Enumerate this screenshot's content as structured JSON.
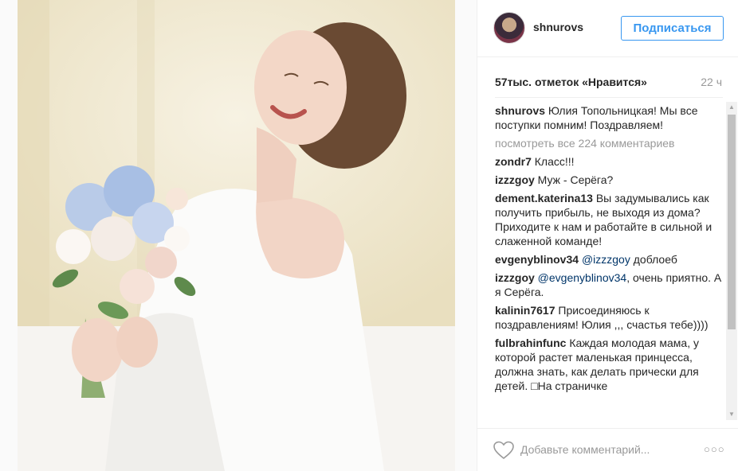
{
  "post": {
    "username": "shnurovs",
    "follow_label": "Подписаться",
    "likes": "57тыс. отметок «Нравится»",
    "time": "22 ч"
  },
  "comments": {
    "caption": {
      "user": "shnurovs",
      "text": "Юлия Топольницкая! Мы все поступки помним! Поздравляем!"
    },
    "view_all": "посмотреть все 224 комментариев",
    "items": [
      {
        "user": "zondr7",
        "text": "Класс!!!"
      },
      {
        "user": "izzzgoy",
        "text": "Муж - Серёга?"
      },
      {
        "user": "dement.katerina13",
        "text": "Вы задумывались как получить прибыль, не выходя из дома? Приходите к нам и работайте в сильной и слаженной команде!"
      },
      {
        "user": "evgenyblinov34",
        "mention": "@izzzgoy",
        "text": "доблоеб"
      },
      {
        "user": "izzzgoy",
        "mention": "@evgenyblinov34",
        "text": ", очень приятно. А я Серёга."
      },
      {
        "user": "kalinin7617",
        "text": "Присоединяюсь к поздравлениям! Юлия ,,, счастья тебе))))"
      },
      {
        "user": "fulbrahinfunc",
        "text": "Каждая молодая мама, у которой растет маленькая принцесса, должна знать, как делать прически для детей. □На страничке"
      }
    ]
  },
  "footer": {
    "comment_placeholder": "Добавьте комментарий...",
    "more_label": "○○○"
  },
  "icons": {
    "like": "heart-icon",
    "more": "more-options-icon",
    "scroll_up": "scroll-up-arrow-icon",
    "scroll_down": "scroll-down-arrow-icon"
  },
  "colors": {
    "accent": "#3897f0",
    "mention": "#003569",
    "muted": "#999999"
  }
}
